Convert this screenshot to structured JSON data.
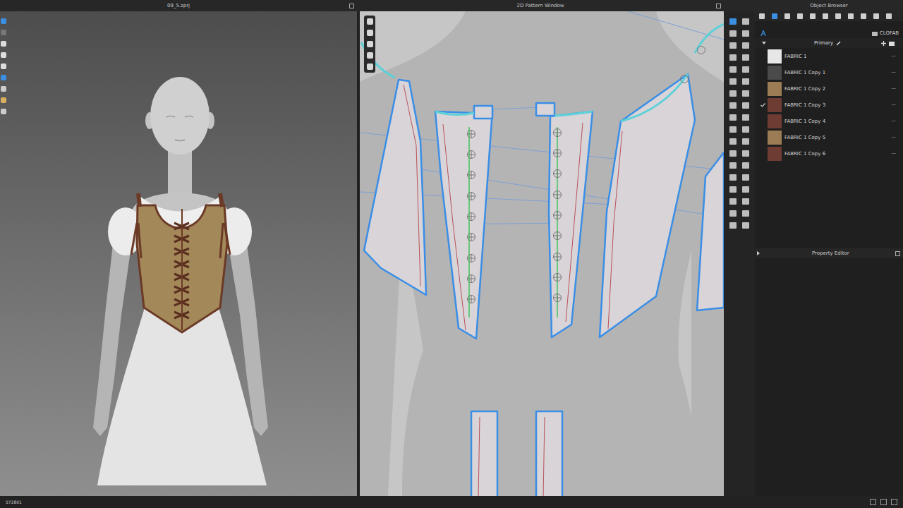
{
  "viewport3d": {
    "title": "09_5.zprj"
  },
  "pattern_window": {
    "title": "2D Pattern Window"
  },
  "object_browser": {
    "title": "Object Browser",
    "library": "CLOFAB",
    "group": "Primary",
    "row_menu": "···",
    "fabrics": [
      {
        "name": "FABRIC 1",
        "selected": false,
        "color": "#e6e6e6"
      },
      {
        "name": "FABRIC 1 Copy 1",
        "selected": false,
        "color": "#4a4a4a"
      },
      {
        "name": "FABRIC 1 Copy 2",
        "selected": false,
        "color": "#9c7c55"
      },
      {
        "name": "FABRIC 1 Copy 3",
        "selected": true,
        "color": "#6e3c33"
      },
      {
        "name": "FABRIC 1 Copy 4",
        "selected": false,
        "color": "#6e3c33"
      },
      {
        "name": "FABRIC 1 Copy 5",
        "selected": false,
        "color": "#9c7c55"
      },
      {
        "name": "FABRIC 1 Copy 6",
        "selected": false,
        "color": "#6e3c33"
      }
    ]
  },
  "property_editor": {
    "title": "Property Editor"
  },
  "status_bar": {
    "text": "572801"
  }
}
